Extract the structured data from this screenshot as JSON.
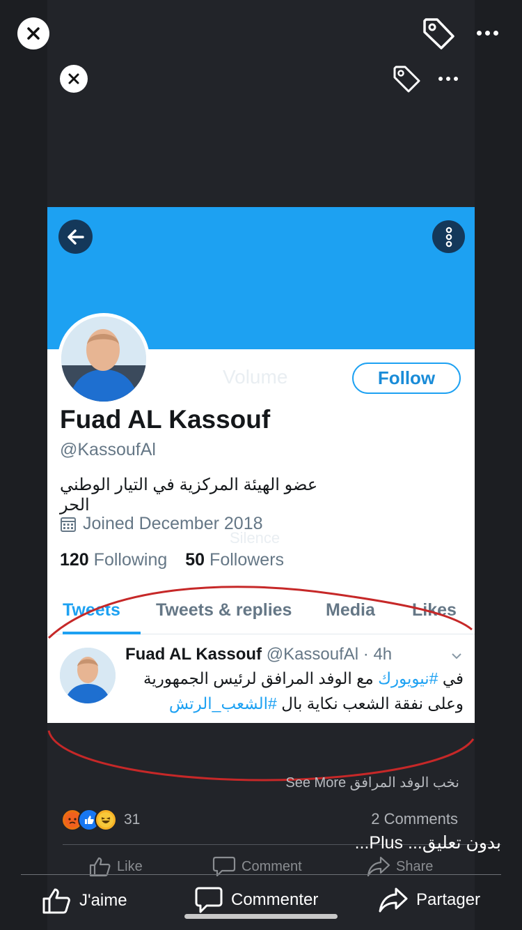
{
  "viewer": {
    "outer_close": "close",
    "inner_close": "close"
  },
  "profile": {
    "name": "Fuad AL Kassouf",
    "handle": "@KassoufAl",
    "bio": "عضو الهيئة المركزية في التيار الوطني الحر",
    "joined": "Joined December 2018",
    "following_count": "120",
    "following_label": "Following",
    "followers_count": "50",
    "followers_label": "Followers",
    "follow_button": "Follow",
    "ghost_volume": "Volume",
    "ghost_silence": "Silence"
  },
  "tabs": [
    {
      "label": "Tweets",
      "active": true
    },
    {
      "label": "Tweets & replies"
    },
    {
      "label": "Media"
    },
    {
      "label": "Likes"
    }
  ],
  "tweet": {
    "author": "Fuad AL Kassouf",
    "handle": "@KassoufAl",
    "time": "· 4h",
    "line1_pre": "في ",
    "line1_hashtag": "#نيويورك",
    "line1_post": " مع الوفد المرافق لرئيس الجمهورية",
    "line2_pre": "وعلى نفقة الشعب نكاية بال ",
    "line2_hashtag": "#الشعب_الرتش"
  },
  "post": {
    "caption": "نخب الوفد المرافق See More",
    "reactions_count": "31",
    "comments_count": "2 Comments",
    "plus_text": "بدون تعليق... Plus...",
    "inner_like": "Like",
    "inner_comment": "Comment",
    "inner_share": "Share",
    "like": "J'aime",
    "comment": "Commenter",
    "share": "Partager"
  },
  "colors": {
    "twitter_blue": "#1da1f2",
    "annotation_red": "#c62828",
    "background": "#1c1e22"
  }
}
